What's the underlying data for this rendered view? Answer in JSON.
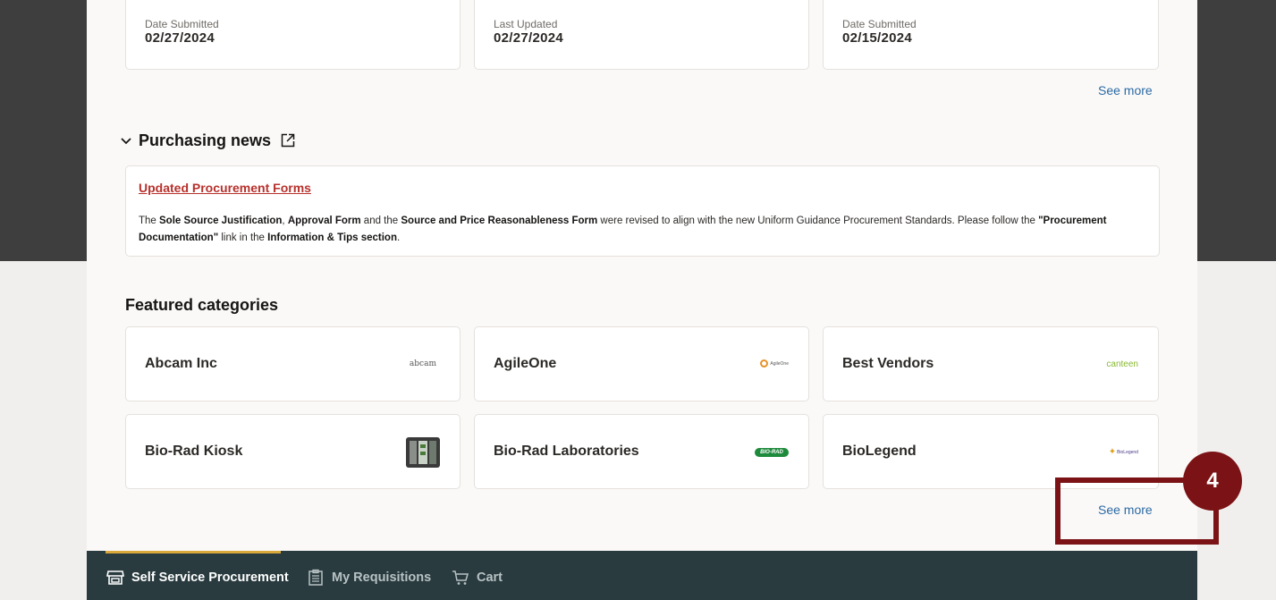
{
  "requisitions": [
    {
      "label": "Date Submitted",
      "value": "02/27/2024"
    },
    {
      "label": "Last Updated",
      "value": "02/27/2024"
    },
    {
      "label": "Date Submitted",
      "value": "02/15/2024"
    }
  ],
  "requisitions_see_more": "See more",
  "purchasing_news": {
    "title": "Purchasing news",
    "item_title": "Updated Procurement Forms",
    "body": {
      "t1": "The ",
      "b1": "Sole Source Justification",
      "t2": ", ",
      "b2": "Approval Form",
      "t3": " and the ",
      "b3": "Source and Price Reasonableness Form",
      "t4": " were revised to align with the new Uniform Guidance Procurement Standards. Please follow the ",
      "b4": "\"Procurement Documentation\"",
      "t5": " link in the ",
      "b5": "Information & Tips section",
      "t6": "."
    }
  },
  "featured": {
    "title": "Featured categories",
    "see_more": "See more",
    "items": [
      {
        "name": "Abcam Inc",
        "logo": "abcam"
      },
      {
        "name": "AgileOne",
        "logo": "AgileOne"
      },
      {
        "name": "Best Vendors",
        "logo": "canteen"
      },
      {
        "name": "Bio-Rad Kiosk",
        "logo": ""
      },
      {
        "name": "Bio-Rad Laboratories",
        "logo": "BIO-RAD"
      },
      {
        "name": "BioLegend",
        "logo": "BioLegend"
      }
    ]
  },
  "step_badge": "4",
  "nav": {
    "items": [
      {
        "label": "Self Service Procurement"
      },
      {
        "label": "My Requisitions"
      },
      {
        "label": "Cart"
      }
    ]
  },
  "colors": {
    "accent_link": "#2b6aa3",
    "news_title": "#b7312c",
    "annotation": "#7b1316",
    "nav_bg": "#293b3f",
    "nav_indicator": "#d9a73a"
  }
}
